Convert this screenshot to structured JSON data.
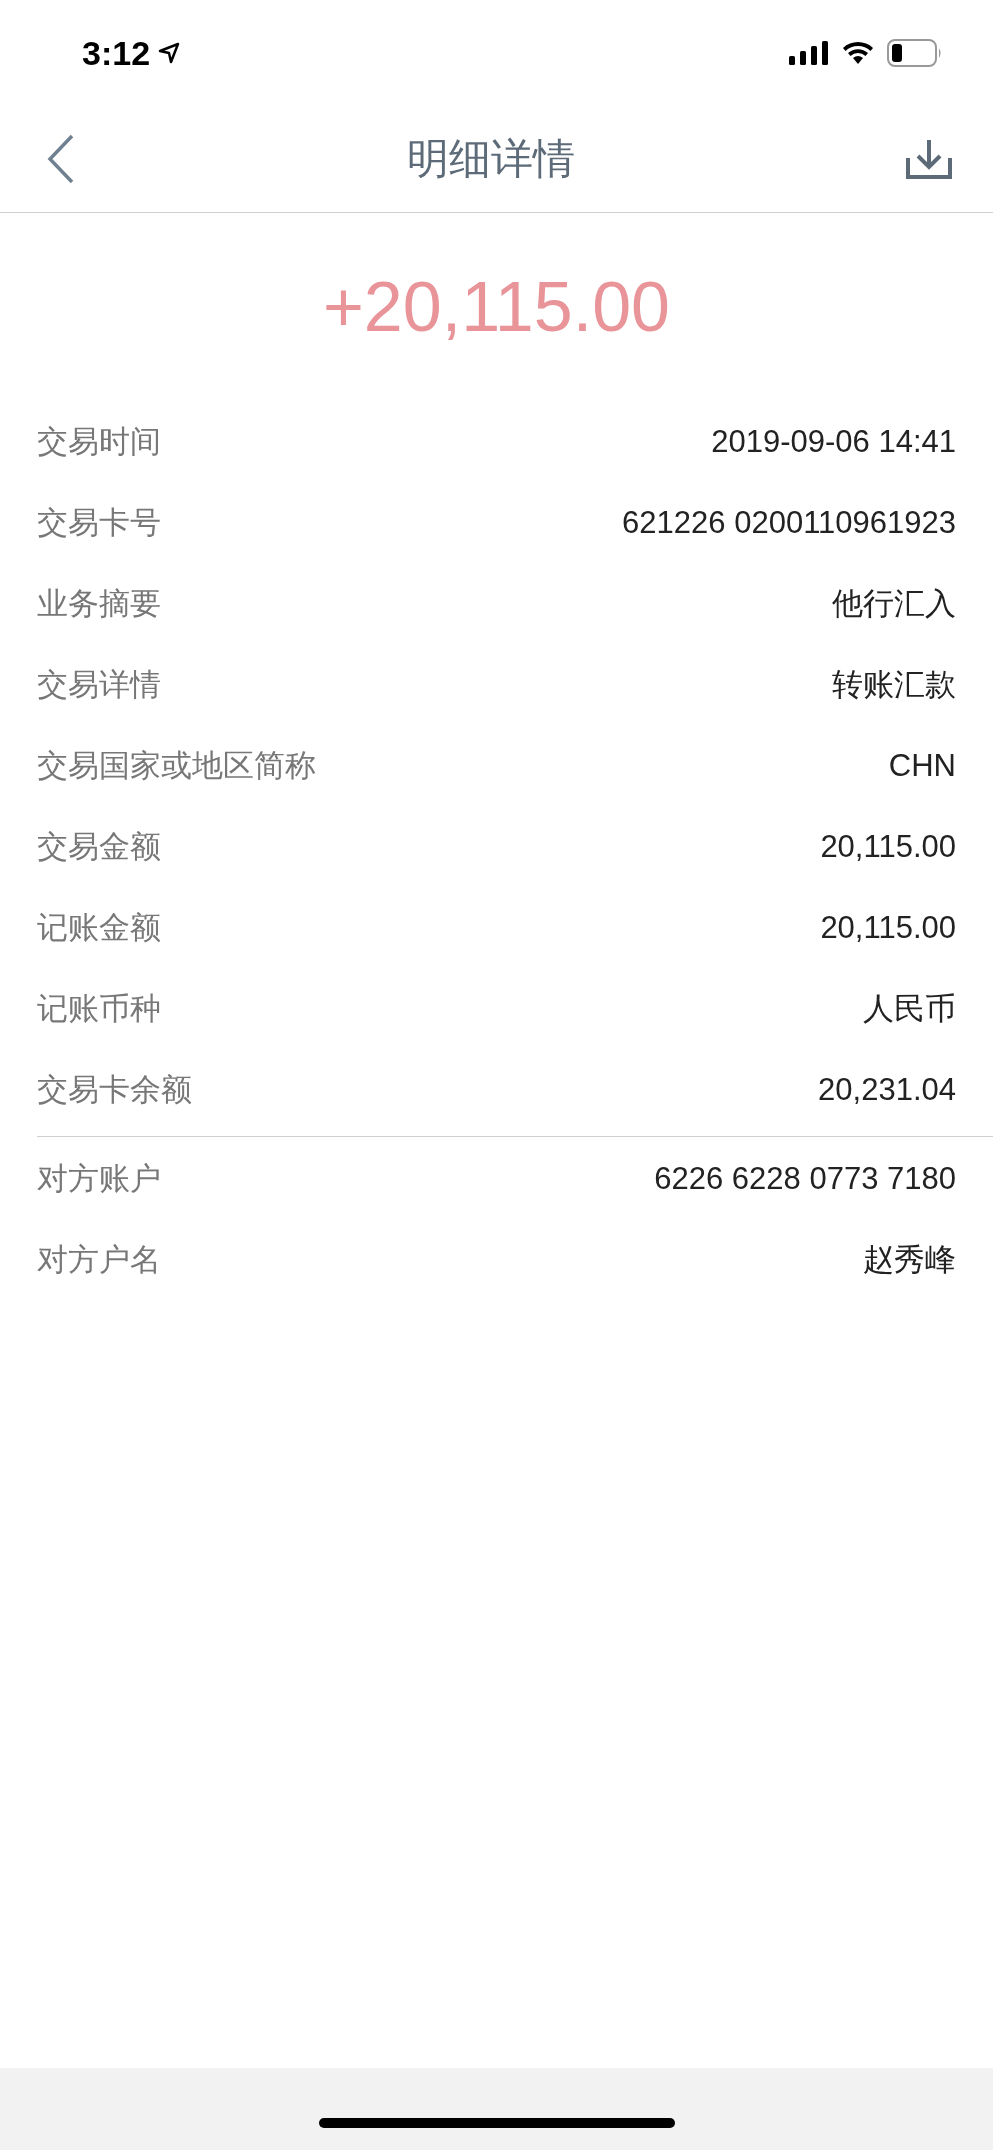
{
  "status_bar": {
    "time": "3:12"
  },
  "header": {
    "title": "明细详情"
  },
  "amount": "+20,115.00",
  "sections": [
    {
      "rows": [
        {
          "label": "交易时间",
          "value": "2019-09-06 14:41"
        },
        {
          "label": "交易卡号",
          "value": "621226 0200110961923"
        },
        {
          "label": "业务摘要",
          "value": "他行汇入"
        },
        {
          "label": "交易详情",
          "value": "转账汇款"
        },
        {
          "label": "交易国家或地区简称",
          "value": "CHN"
        },
        {
          "label": "交易金额",
          "value": "20,115.00"
        },
        {
          "label": "记账金额",
          "value": "20,115.00"
        },
        {
          "label": "记账币种",
          "value": "人民币"
        },
        {
          "label": "交易卡余额",
          "value": "20,231.04"
        }
      ]
    },
    {
      "rows": [
        {
          "label": "对方账户",
          "value": "6226 6228 0773 7180"
        },
        {
          "label": "对方户名",
          "value": "赵秀峰"
        }
      ]
    }
  ]
}
